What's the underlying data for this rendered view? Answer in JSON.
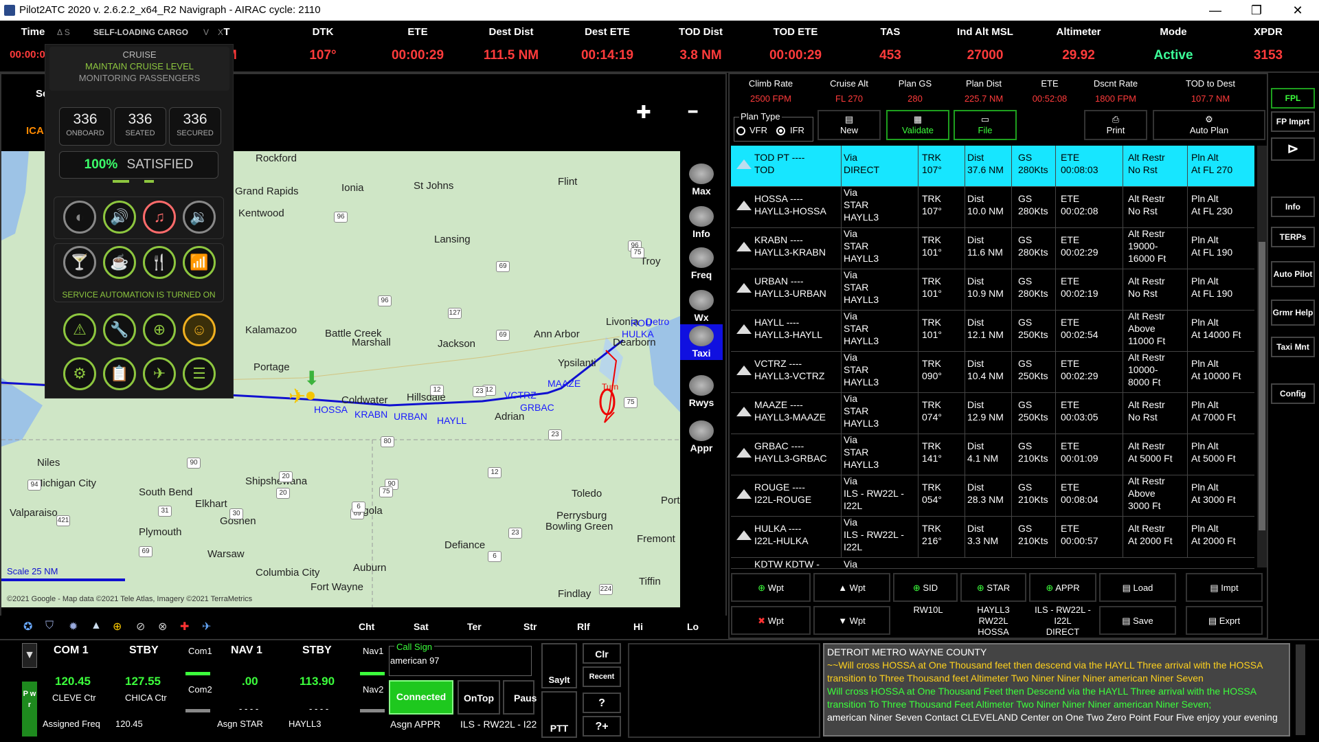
{
  "titlebar": {
    "title": "Pilot2ATC 2020 v. 2.6.2.2_x64_R2    Navigraph - AIRAC cycle: 2110",
    "minimize": "—",
    "restore": "❐",
    "close": "✕"
  },
  "topstrip": {
    "time_label": "Time",
    "time_value": "00:00:0",
    "cols": [
      {
        "h": "T",
        "v": "NM"
      },
      {
        "h": "DTK",
        "v": "107°"
      },
      {
        "h": "ETE",
        "v": "00:00:29"
      },
      {
        "h": "Dest Dist",
        "v": "111.5 NM"
      },
      {
        "h": "Dest ETE",
        "v": "00:14:19"
      },
      {
        "h": "TOD Dist",
        "v": "3.8 NM"
      },
      {
        "h": "TOD ETE",
        "v": "00:00:29"
      },
      {
        "h": "TAS",
        "v": "453"
      },
      {
        "h": "Ind Alt MSL",
        "v": "27000"
      },
      {
        "h": "Altimeter",
        "v": "29.92"
      },
      {
        "h": "Mode",
        "v": "Active"
      },
      {
        "h": "XPDR",
        "v": "3153"
      }
    ]
  },
  "cargo": {
    "header_icons": "Δ  S",
    "title": "SELF-LOADING CARGO",
    "header_v": "V",
    "header_x": "X",
    "phase": "CRUISE",
    "status1": "MAINTAIN CRUISE LEVEL",
    "status2": "MONITORING PASSENGERS",
    "counts": [
      {
        "n": "336",
        "l": "ONBOARD"
      },
      {
        "n": "336",
        "l": "SEATED"
      },
      {
        "n": "336",
        "l": "SECURED"
      }
    ],
    "satisfied_pct": "100%",
    "satisfied_label": "SATISFIED",
    "automation": "SERVICE AUTOMATION IS TURNED ON"
  },
  "mapside": {
    "se": "Se",
    "ica": "ICA",
    "plus": "✚",
    "minus": "━"
  },
  "map": {
    "scale": "Scale 25 NM",
    "copyright": "©2021 Google - Map data ©2021 Tele Atlas, Imagery ©2021 TerraMetrics",
    "cities": [
      "Rockford",
      "Grand Rapids",
      "Ionia",
      "St Johns",
      "Flint",
      "Kentwood",
      "Lansing",
      "Troy",
      "Kalamazoo",
      "Battle Creek",
      "Marshall",
      "Jackson",
      "Ann Arbor",
      "Livonia",
      "Dearborn",
      "Portage",
      "Coldwater",
      "Hillsdale",
      "Adrian",
      "Ypsilanti",
      "Niles",
      "Michigan City",
      "South Bend",
      "Elkhart",
      "Goshen",
      "Shipshewana",
      "Angola",
      "Toledo",
      "Perrysburg",
      "Valparaiso",
      "Plymouth",
      "Warsaw",
      "Auburn",
      "Defiance",
      "Bowling Green",
      "Fremont",
      "Columbia City",
      "Fort Wayne",
      "Findlay",
      "Tiffin",
      "Port"
    ],
    "waypoints": [
      "HOSSA",
      "KRABN",
      "URBAN",
      "HAYLL",
      "VCTRZ",
      "GRBAC",
      "MAAZE",
      "ROU",
      "HULKA",
      "Detro"
    ],
    "turn": "Turn",
    "highways": [
      "96",
      "96",
      "75",
      "69",
      "96",
      "127",
      "69",
      "12",
      "12",
      "23",
      "23",
      "75",
      "80",
      "90",
      "94",
      "20",
      "69",
      "6",
      "23",
      "75",
      "12",
      "421",
      "31",
      "30",
      "90",
      "20",
      "69",
      "6",
      "224"
    ],
    "bottom_tabs": [
      "Cht",
      "Sat",
      "Ter",
      "Str",
      "Rlf",
      "Hi",
      "Lo"
    ]
  },
  "side_tools": [
    {
      "label": "Max"
    },
    {
      "label": "Info"
    },
    {
      "label": "Freq"
    },
    {
      "label": "Wx"
    },
    {
      "label": "Taxi"
    },
    {
      "label": "Rwys"
    },
    {
      "label": "Appr"
    }
  ],
  "plan": {
    "stats": [
      {
        "h": "Climb Rate",
        "v": "2500 FPM"
      },
      {
        "h": "Cruise Alt",
        "v": "FL 270"
      },
      {
        "h": "Plan GS",
        "v": "280"
      },
      {
        "h": "Plan Dist",
        "v": "225.7 NM"
      },
      {
        "h": "ETE",
        "v": "00:52:08"
      },
      {
        "h": "Dscnt Rate",
        "v": "1800 FPM"
      },
      {
        "h": "TOD to Dest",
        "v": "107.7 NM"
      }
    ],
    "plan_type": "Plan Type",
    "vfr": "VFR",
    "ifr": "IFR",
    "buttons": {
      "new": "New",
      "validate": "Validate",
      "file": "File",
      "print": "Print",
      "auto_plan": "Auto Plan"
    },
    "rows": [
      {
        "wp": "TOD PT  ----",
        "wp2": "TOD",
        "via": "Via",
        "via2": "DIRECT",
        "via3": "",
        "trk": "TRK",
        "trk2": "107°",
        "dist": "Dist",
        "dist2": "37.6 NM",
        "gs": "GS",
        "gs2": "280Kts",
        "ete": "ETE",
        "ete2": "00:08:03",
        "alt": "Alt Restr",
        "alt2": "No Rst",
        "alt3": "",
        "pln": "Pln Alt",
        "pln2": "At FL 270"
      },
      {
        "wp": "HOSSA  ----",
        "wp2": "HAYLL3-HOSSA",
        "via": "Via",
        "via2": "STAR",
        "via3": "HAYLL3",
        "trk": "TRK",
        "trk2": "107°",
        "dist": "Dist",
        "dist2": "10.0 NM",
        "gs": "GS",
        "gs2": "280Kts",
        "ete": "ETE",
        "ete2": "00:02:08",
        "alt": "Alt Restr",
        "alt2": "No Rst",
        "alt3": "",
        "pln": "Pln Alt",
        "pln2": "At FL 230"
      },
      {
        "wp": "KRABN  ----",
        "wp2": "HAYLL3-KRABN",
        "via": "Via",
        "via2": "STAR",
        "via3": "HAYLL3",
        "trk": "TRK",
        "trk2": "101°",
        "dist": "Dist",
        "dist2": "11.6 NM",
        "gs": "GS",
        "gs2": "280Kts",
        "ete": "ETE",
        "ete2": "00:02:29",
        "alt": "Alt Restr",
        "alt2": "19000-",
        "alt3": "16000 Ft",
        "pln": "Pln Alt",
        "pln2": "At FL 190"
      },
      {
        "wp": "URBAN  ----",
        "wp2": "HAYLL3-URBAN",
        "via": "Via",
        "via2": "STAR",
        "via3": "HAYLL3",
        "trk": "TRK",
        "trk2": "101°",
        "dist": "Dist",
        "dist2": "10.9 NM",
        "gs": "GS",
        "gs2": "280Kts",
        "ete": "ETE",
        "ete2": "00:02:19",
        "alt": "Alt Restr",
        "alt2": "No Rst",
        "alt3": "",
        "pln": "Pln Alt",
        "pln2": "At FL 190"
      },
      {
        "wp": "HAYLL  ----",
        "wp2": "HAYLL3-HAYLL",
        "via": "Via",
        "via2": "STAR",
        "via3": "HAYLL3",
        "trk": "TRK",
        "trk2": "101°",
        "dist": "Dist",
        "dist2": "12.1 NM",
        "gs": "GS",
        "gs2": "250Kts",
        "ete": "ETE",
        "ete2": "00:02:54",
        "alt": "Alt Restr",
        "alt2": "Above",
        "alt3": "11000 Ft",
        "pln": "Pln Alt",
        "pln2": "At 14000 Ft"
      },
      {
        "wp": "VCTRZ  ----",
        "wp2": "HAYLL3-VCTRZ",
        "via": "Via",
        "via2": "STAR",
        "via3": "HAYLL3",
        "trk": "TRK",
        "trk2": "090°",
        "dist": "Dist",
        "dist2": "10.4 NM",
        "gs": "GS",
        "gs2": "250Kts",
        "ete": "ETE",
        "ete2": "00:02:29",
        "alt": "Alt Restr",
        "alt2": "10000-",
        "alt3": "8000 Ft",
        "pln": "Pln Alt",
        "pln2": "At 10000 Ft"
      },
      {
        "wp": "MAAZE  ----",
        "wp2": "HAYLL3-MAAZE",
        "via": "Via",
        "via2": "STAR",
        "via3": "HAYLL3",
        "trk": "TRK",
        "trk2": "074°",
        "dist": "Dist",
        "dist2": "12.9 NM",
        "gs": "GS",
        "gs2": "250Kts",
        "ete": "ETE",
        "ete2": "00:03:05",
        "alt": "Alt Restr",
        "alt2": "No Rst",
        "alt3": "",
        "pln": "Pln Alt",
        "pln2": "At 7000 Ft"
      },
      {
        "wp": "GRBAC  ----",
        "wp2": "HAYLL3-GRBAC",
        "via": "Via",
        "via2": "STAR",
        "via3": "HAYLL3",
        "trk": "TRK",
        "trk2": "141°",
        "dist": "Dist",
        "dist2": "4.1 NM",
        "gs": "GS",
        "gs2": "210Kts",
        "ete": "ETE",
        "ete2": "00:01:09",
        "alt": "Alt Restr",
        "alt2": "At 5000 Ft",
        "alt3": "",
        "pln": "Pln Alt",
        "pln2": "At 5000 Ft"
      },
      {
        "wp": "ROUGE  ----",
        "wp2": "I22L-ROUGE",
        "via": "Via",
        "via2": "ILS - RW22L -",
        "via3": "I22L",
        "trk": "TRK",
        "trk2": "054°",
        "dist": "Dist",
        "dist2": "28.3 NM",
        "gs": "GS",
        "gs2": "210Kts",
        "ete": "ETE",
        "ete2": "00:08:04",
        "alt": "Alt Restr",
        "alt2": "Above",
        "alt3": "3000 Ft",
        "pln": "Pln Alt",
        "pln2": "At 3000 Ft"
      },
      {
        "wp": "HULKA  ----",
        "wp2": "I22L-HULKA",
        "via": "Via",
        "via2": "ILS - RW22L -",
        "via3": "I22L",
        "trk": "TRK",
        "trk2": "216°",
        "dist": "Dist",
        "dist2": "3.3 NM",
        "gs": "GS",
        "gs2": "210Kts",
        "ete": "ETE",
        "ete2": "00:00:57",
        "alt": "Alt Restr",
        "alt2": "At 2000 Ft",
        "alt3": "",
        "pln": "Pln Alt",
        "pln2": "At 2000 Ft"
      }
    ],
    "partial_row": {
      "wp": "KDTW  KDTW -",
      "via": "Via"
    },
    "edit": {
      "add_wpt": "Wpt",
      "up_wpt": "Wpt",
      "sid": "SID",
      "star": "STAR",
      "appr": "APPR",
      "load": "Load",
      "impt": "Impt",
      "del_wpt": "Wpt",
      "down_wpt": "Wpt",
      "save": "Save",
      "expt": "Exprt",
      "sid_val": "RW10L",
      "star_val1": "HAYLL3",
      "star_val2": "RW22L",
      "star_val3": "HOSSA",
      "appr_val1": "ILS - RW22L -",
      "appr_val2": "I22L",
      "appr_val3": "DIRECT"
    }
  },
  "fpl_col": [
    "FPL",
    "FP Imprt",
    "Info",
    "TERPs",
    "Auto Pilot",
    "Grmr Help",
    "Taxi Mnt",
    "Config"
  ],
  "radio": {
    "com1": "COM 1",
    "stby": "STBY",
    "com1_freq": "120.45",
    "com1_stby": "127.55",
    "com1_name": "CLEVE Ctr",
    "stby_name": "CHICA Ctr",
    "com1_small": "Com1",
    "com2_small": "Com2",
    "nav1": "NAV 1",
    "nav_stby": "STBY",
    "nav1_freq": ".00",
    "nav1_stby": "113.90",
    "nav1_small": "Nav1",
    "nav2_small": "Nav2",
    "dashes": "- - - -",
    "assigned_freq_label": "Assigned Freq",
    "assigned_freq": "120.45",
    "asgn_star": "Asgn STAR",
    "star_val": "HAYLL3",
    "pwr": "P w r"
  },
  "callsign": {
    "label": "Call Sign",
    "value": "american 97",
    "connected": "Connected",
    "ontop": "OnTop",
    "pause": "Paus",
    "asgn_appr": "Asgn APPR",
    "appr_val": "ILS - RW22L - I22"
  },
  "say": {
    "sayit": "SayIt",
    "clr": "Clr",
    "recent": "Recent",
    "ptt": "PTT",
    "q": "?",
    "qplus": "?+"
  },
  "log": {
    "line1": "DETROIT METRO WAYNE COUNTY",
    "line2": "~~Will cross HOSSA at One Thousand feet  then descend via the HAYLL Three  arrival  with the HOSSA transition  to Three Thousand feet   Altimeter Two Niner Niner Niner american Niner Seven",
    "line3": " Will cross HOSSA at One Thousand Feet then Descend via the HAYLL Three arrival with the HOSSA transition To Three Thousand Feet Altimeter Two Niner Niner Niner american Niner Seven;",
    "line4": "american Niner Seven Contact CLEVELAND Center on One Two Zero Point Four Five enjoy your evening"
  }
}
